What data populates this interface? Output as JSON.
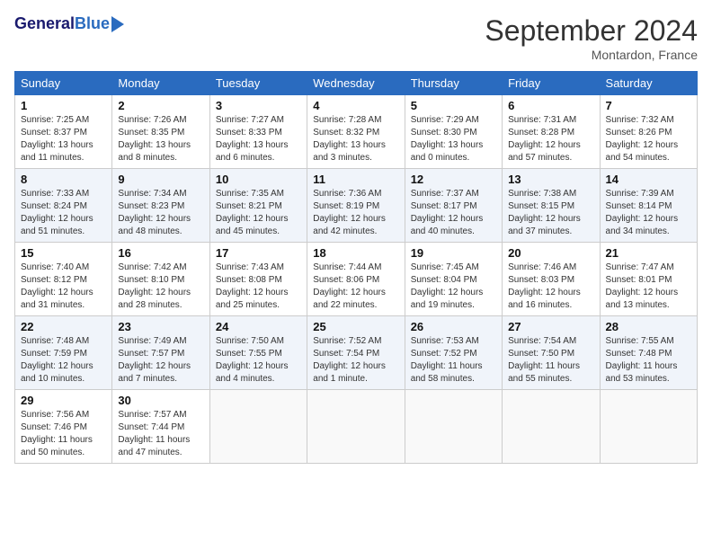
{
  "header": {
    "logo_line1": "General",
    "logo_line2": "Blue",
    "month_title": "September 2024",
    "location": "Montardon, France"
  },
  "columns": [
    "Sunday",
    "Monday",
    "Tuesday",
    "Wednesday",
    "Thursday",
    "Friday",
    "Saturday"
  ],
  "weeks": [
    [
      {
        "day": "1",
        "info": "Sunrise: 7:25 AM\nSunset: 8:37 PM\nDaylight: 13 hours\nand 11 minutes."
      },
      {
        "day": "2",
        "info": "Sunrise: 7:26 AM\nSunset: 8:35 PM\nDaylight: 13 hours\nand 8 minutes."
      },
      {
        "day": "3",
        "info": "Sunrise: 7:27 AM\nSunset: 8:33 PM\nDaylight: 13 hours\nand 6 minutes."
      },
      {
        "day": "4",
        "info": "Sunrise: 7:28 AM\nSunset: 8:32 PM\nDaylight: 13 hours\nand 3 minutes."
      },
      {
        "day": "5",
        "info": "Sunrise: 7:29 AM\nSunset: 8:30 PM\nDaylight: 13 hours\nand 0 minutes."
      },
      {
        "day": "6",
        "info": "Sunrise: 7:31 AM\nSunset: 8:28 PM\nDaylight: 12 hours\nand 57 minutes."
      },
      {
        "day": "7",
        "info": "Sunrise: 7:32 AM\nSunset: 8:26 PM\nDaylight: 12 hours\nand 54 minutes."
      }
    ],
    [
      {
        "day": "8",
        "info": "Sunrise: 7:33 AM\nSunset: 8:24 PM\nDaylight: 12 hours\nand 51 minutes."
      },
      {
        "day": "9",
        "info": "Sunrise: 7:34 AM\nSunset: 8:23 PM\nDaylight: 12 hours\nand 48 minutes."
      },
      {
        "day": "10",
        "info": "Sunrise: 7:35 AM\nSunset: 8:21 PM\nDaylight: 12 hours\nand 45 minutes."
      },
      {
        "day": "11",
        "info": "Sunrise: 7:36 AM\nSunset: 8:19 PM\nDaylight: 12 hours\nand 42 minutes."
      },
      {
        "day": "12",
        "info": "Sunrise: 7:37 AM\nSunset: 8:17 PM\nDaylight: 12 hours\nand 40 minutes."
      },
      {
        "day": "13",
        "info": "Sunrise: 7:38 AM\nSunset: 8:15 PM\nDaylight: 12 hours\nand 37 minutes."
      },
      {
        "day": "14",
        "info": "Sunrise: 7:39 AM\nSunset: 8:14 PM\nDaylight: 12 hours\nand 34 minutes."
      }
    ],
    [
      {
        "day": "15",
        "info": "Sunrise: 7:40 AM\nSunset: 8:12 PM\nDaylight: 12 hours\nand 31 minutes."
      },
      {
        "day": "16",
        "info": "Sunrise: 7:42 AM\nSunset: 8:10 PM\nDaylight: 12 hours\nand 28 minutes."
      },
      {
        "day": "17",
        "info": "Sunrise: 7:43 AM\nSunset: 8:08 PM\nDaylight: 12 hours\nand 25 minutes."
      },
      {
        "day": "18",
        "info": "Sunrise: 7:44 AM\nSunset: 8:06 PM\nDaylight: 12 hours\nand 22 minutes."
      },
      {
        "day": "19",
        "info": "Sunrise: 7:45 AM\nSunset: 8:04 PM\nDaylight: 12 hours\nand 19 minutes."
      },
      {
        "day": "20",
        "info": "Sunrise: 7:46 AM\nSunset: 8:03 PM\nDaylight: 12 hours\nand 16 minutes."
      },
      {
        "day": "21",
        "info": "Sunrise: 7:47 AM\nSunset: 8:01 PM\nDaylight: 12 hours\nand 13 minutes."
      }
    ],
    [
      {
        "day": "22",
        "info": "Sunrise: 7:48 AM\nSunset: 7:59 PM\nDaylight: 12 hours\nand 10 minutes."
      },
      {
        "day": "23",
        "info": "Sunrise: 7:49 AM\nSunset: 7:57 PM\nDaylight: 12 hours\nand 7 minutes."
      },
      {
        "day": "24",
        "info": "Sunrise: 7:50 AM\nSunset: 7:55 PM\nDaylight: 12 hours\nand 4 minutes."
      },
      {
        "day": "25",
        "info": "Sunrise: 7:52 AM\nSunset: 7:54 PM\nDaylight: 12 hours\nand 1 minute."
      },
      {
        "day": "26",
        "info": "Sunrise: 7:53 AM\nSunset: 7:52 PM\nDaylight: 11 hours\nand 58 minutes."
      },
      {
        "day": "27",
        "info": "Sunrise: 7:54 AM\nSunset: 7:50 PM\nDaylight: 11 hours\nand 55 minutes."
      },
      {
        "day": "28",
        "info": "Sunrise: 7:55 AM\nSunset: 7:48 PM\nDaylight: 11 hours\nand 53 minutes."
      }
    ],
    [
      {
        "day": "29",
        "info": "Sunrise: 7:56 AM\nSunset: 7:46 PM\nDaylight: 11 hours\nand 50 minutes."
      },
      {
        "day": "30",
        "info": "Sunrise: 7:57 AM\nSunset: 7:44 PM\nDaylight: 11 hours\nand 47 minutes."
      },
      {
        "day": "",
        "info": ""
      },
      {
        "day": "",
        "info": ""
      },
      {
        "day": "",
        "info": ""
      },
      {
        "day": "",
        "info": ""
      },
      {
        "day": "",
        "info": ""
      }
    ]
  ]
}
